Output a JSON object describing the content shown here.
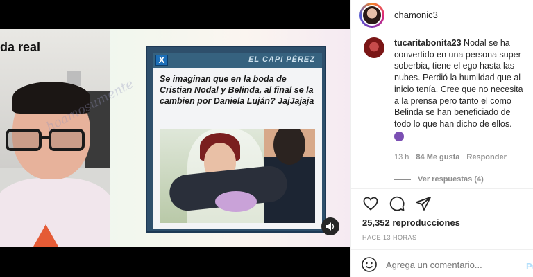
{
  "video": {
    "overlay_title": "da real",
    "watermark": "hoamosumente",
    "card": {
      "close_glyph": "X",
      "brand": "EL CAPI PÉREZ",
      "text": "Se imaginan que en la boda de Cristian Nodal y Belinda, al final se la cambien por Daniela Luján? JajJajaja"
    },
    "sound_icon": "speaker-icon"
  },
  "post": {
    "username": "chamonic3",
    "comment": {
      "username": "tucaritabonita23",
      "text": "Nodal se ha convertido en una persona super soberbia, tiene el ego hasta las nubes. Perdió la humildad que al inicio tenía. Cree que no necesita a la prensa pero tanto el como Belinda se han beneficiado de todo lo que han dicho de ellos.",
      "time": "13 h",
      "likes": "84 Me gusta",
      "reply": "Responder",
      "view_replies": "Ver respuestas (4)"
    },
    "views": "25,352 reproducciones",
    "ago": "HACE 13 HORAS",
    "add_comment_placeholder": "Agrega un comentario...",
    "post_button": "Pu"
  },
  "colors": {
    "accent": "#0095f6",
    "card_frame": "#2e4f6b",
    "muted": "#8e8e8e"
  }
}
